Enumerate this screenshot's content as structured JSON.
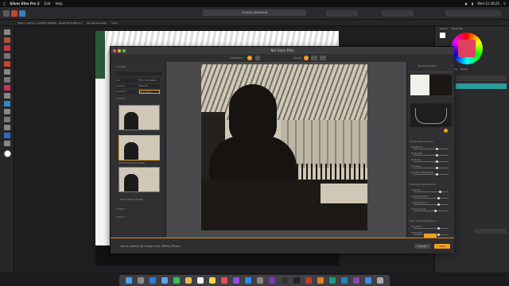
{
  "menubar": {
    "app": "Silver Efex Pro 2",
    "items": [
      "Edit",
      "Help"
    ],
    "clock": "Wed 11:38:25"
  },
  "context": {
    "doc_info": "1621 x 1621px, 2.63MP, RGBA/8 - sRGB IEC61966-2.1",
    "no_camera": "No Camera Data",
    "units": "Units"
  },
  "doc_tab": "Untitled (Modified)",
  "right_panel": {
    "tabs": [
      "Colour",
      "Swatches"
    ],
    "layer_tabs": [
      "Layers",
      "Effects",
      "Styles"
    ]
  },
  "plugin": {
    "window_title": "Nik Silver Efex",
    "toolbar": {
      "zoom_label": "Zoom",
      "preview_label": "Compare"
    },
    "left": {
      "presets_heading": "Presets",
      "tags": [
        "All",
        "Film Simulation",
        "Classic",
        "Modern",
        "Custom",
        "Imported"
      ],
      "history_heading": "History",
      "selected_preset": "033 Full Dynamic (Harsh)",
      "bottom_items": [
        "Add Custom Preset",
        "Import",
        "Export"
      ]
    },
    "right": {
      "brand": "Nik Silver Efex",
      "sections": [
        {
          "heading": "Global Adjustments",
          "rows": [
            "Brightness",
            "Highlights",
            "Midtones",
            "Shadows",
            "Dynamic Brightness"
          ]
        },
        {
          "heading": "Contrast Adjustments",
          "rows": [
            "Contrast",
            "Amplify Whites",
            "Amplify Blacks",
            "Soft Contrast"
          ]
        },
        {
          "heading": "Structure Adjustments",
          "rows": [
            "Structure",
            "Highlights"
          ]
        }
      ]
    },
    "footer": {
      "status": "You're modifying image from Affinity Photo",
      "cancel": "Cancel",
      "ok": "Save"
    }
  },
  "colors": {
    "accent": "#f0a020",
    "footer_line": "#e08c18",
    "teal_layer": "#2a9b9b"
  }
}
